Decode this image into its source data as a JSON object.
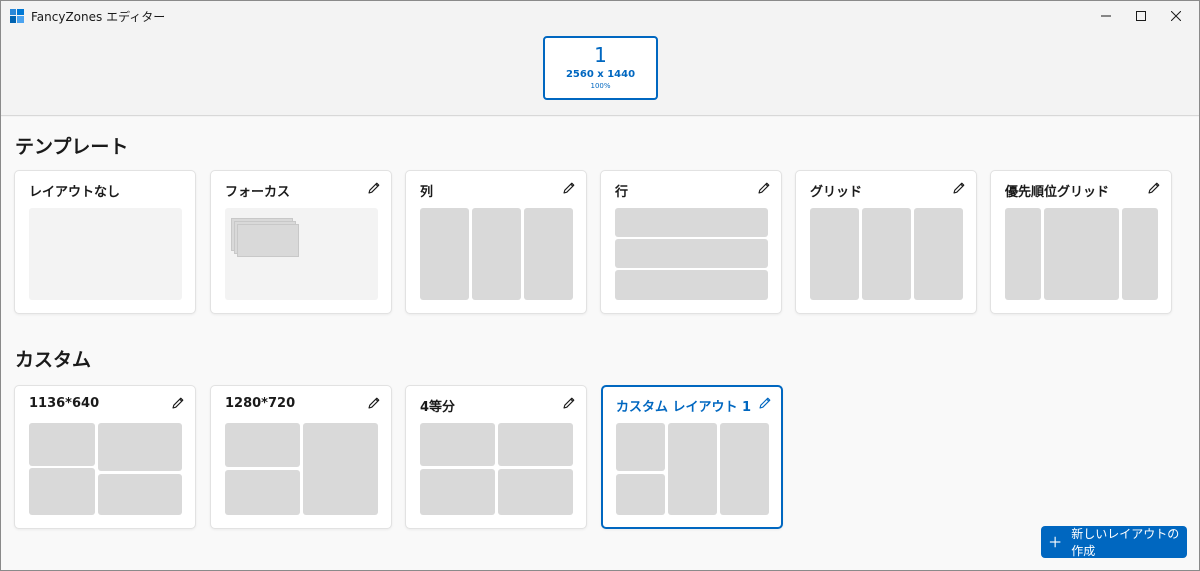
{
  "window": {
    "title": "FancyZones エディター",
    "controls": [
      "minimize-icon",
      "maximize-icon",
      "close-icon"
    ]
  },
  "monitor": {
    "number": "1",
    "resolution": "2560 x 1440",
    "scale": "100%"
  },
  "templates": {
    "title": "テンプレート",
    "items": [
      {
        "name": "レイアウトなし",
        "editable": false
      },
      {
        "name": "フォーカス",
        "editable": true
      },
      {
        "name": "列",
        "editable": true
      },
      {
        "name": "行",
        "editable": true
      },
      {
        "name": "グリッド",
        "editable": true
      },
      {
        "name": "優先順位グリッド",
        "editable": true
      }
    ]
  },
  "custom": {
    "title": "カスタム",
    "items": [
      {
        "name": "1136*640",
        "editable": true,
        "selected": false
      },
      {
        "name": "1280*720",
        "editable": true,
        "selected": false
      },
      {
        "name": "4等分",
        "editable": true,
        "selected": false
      },
      {
        "name": "カスタム レイアウト 1",
        "editable": true,
        "selected": true
      }
    ]
  },
  "actions": {
    "new_layout_label": "新しいレイアウトの作成"
  },
  "colors": {
    "accent": "#0067c0",
    "zone": "#d9d9d9",
    "card": "#ffffff",
    "background": "#f9f9f9"
  }
}
